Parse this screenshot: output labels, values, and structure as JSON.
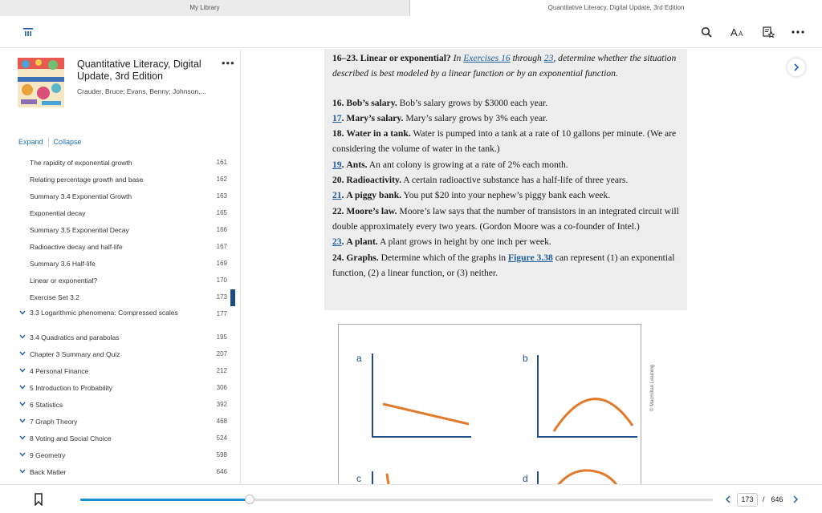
{
  "tabs": {
    "left": "My Library",
    "right": "Quantitative Literacy, Digital Update, 3rd Edition"
  },
  "toolbar": {
    "menu_icon": "menu-icon",
    "search_icon": "search-icon",
    "font_icon": "font-size-icon",
    "notes_icon": "notes-icon",
    "more_icon": "more-icon"
  },
  "book": {
    "title": "Quantitative Literacy, Digital Update, 3rd Edition",
    "authors": "Crauder, Bruce; Evans, Benny; Johnson,...",
    "more": "•••"
  },
  "toc_controls": {
    "expand": "Expand",
    "collapse": "Collapse"
  },
  "toc": [
    {
      "label": "The rapidity of exponential growth",
      "page": "161"
    },
    {
      "label": "Relating percentage growth and base",
      "page": "162"
    },
    {
      "label": "Summary 3.4 Exponential Growth",
      "page": "163"
    },
    {
      "label": "Exponential decay",
      "page": "165"
    },
    {
      "label": "Summary 3.5 Exponential Decay",
      "page": "166"
    },
    {
      "label": "Radioactive decay and half-life",
      "page": "167"
    },
    {
      "label": "Summary 3.6 Half-life",
      "page": "169"
    },
    {
      "label": "Linear or exponential?",
      "page": "170"
    },
    {
      "label": "Exercise Set 3.2",
      "page": "173"
    },
    {
      "label": "3.3 Logarithmic phenomena: Compressed scales",
      "page": "177"
    },
    {
      "label": "3.4 Quadratics and parabolas",
      "page": "195"
    },
    {
      "label": "Chapter 3 Summary and Quiz",
      "page": "207"
    },
    {
      "label": "4 Personal Finance",
      "page": "212"
    },
    {
      "label": "5 Introduction to Probability",
      "page": "306"
    },
    {
      "label": "6 Statistics",
      "page": "392"
    },
    {
      "label": "7 Graph Theory",
      "page": "468"
    },
    {
      "label": "8 Voting and Social Choice",
      "page": "524"
    },
    {
      "label": "9 Geometry",
      "page": "598"
    },
    {
      "label": "Back Matter",
      "page": "646"
    }
  ],
  "content": {
    "intro_head": "16–23. Linear or exponential?",
    "intro_a": " In ",
    "intro_link1": "Exercises 16",
    "intro_b": " through ",
    "intro_link2": "23",
    "intro_c": ", determine whether the situation described is best modeled by a linear function or by an exponential function.",
    "items": [
      {
        "num": "16.",
        "linked": false,
        "head": "Bob’s salary.",
        "body": " Bob’s salary grows by $3000 each year."
      },
      {
        "num": "17",
        "linked": true,
        "head": "Mary’s salary.",
        "body": " Mary’s salary grows by 3% each year."
      },
      {
        "num": "18.",
        "linked": false,
        "head": "Water in a tank.",
        "body": " Water is pumped into a tank at a rate of 10 gallons per minute. (We are considering the volume of water in the tank.)"
      },
      {
        "num": "19",
        "linked": true,
        "head": "Ants.",
        "body": " An ant colony is growing at a rate of 2% each month."
      },
      {
        "num": "20.",
        "linked": false,
        "head": "Radioactivity.",
        "body": " A certain radioactive substance has a half-life of three years."
      },
      {
        "num": "21",
        "linked": true,
        "head": "A piggy bank.",
        "body": " You put $20 into your nephew’s piggy bank each week."
      },
      {
        "num": "22.",
        "linked": false,
        "head": "Moore’s law.",
        "body": " Moore’s law says that the number of transistors in an integrated circuit will double approximately every two years. (Gordon Moore was a co-founder of Intel.)"
      },
      {
        "num": "23",
        "linked": true,
        "head": "A plant.",
        "body": " A plant grows in height by one inch per week."
      },
      {
        "num": "24.",
        "linked": false,
        "head": "Graphs.",
        "body_a": " Determine which of the graphs in ",
        "fig_link": "Figure 3.38",
        "body_b": " can represent (1) an exponential function, (2) a linear function, or (3) neither."
      }
    ],
    "figure": {
      "labels": [
        "a",
        "b",
        "c",
        "d"
      ],
      "credit": "© Macmillan Learning",
      "line_color": "#e07a2a",
      "axis_color": "#1f4f8f"
    }
  },
  "progress": {
    "current_page": "173",
    "separator": "/",
    "total_pages": "646",
    "fraction": 0.268
  },
  "colors": {
    "accent": "#1a8fd0",
    "link": "#1f5e9a",
    "toc_marker": "#1a4c86"
  }
}
